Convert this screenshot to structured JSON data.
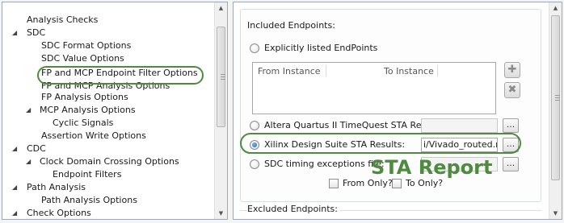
{
  "tree": {
    "items": [
      {
        "label": "Analysis Checks",
        "expander": ""
      },
      {
        "label": "SDC",
        "expander": "◢"
      },
      {
        "label": "SDC Format Options",
        "expander": ""
      },
      {
        "label": "SDC Value Options",
        "expander": ""
      },
      {
        "label": "FP and MCP Endpoint Filter Options",
        "expander": ""
      },
      {
        "label": "FP and MCP Analysis Options",
        "expander": ""
      },
      {
        "label": "FP Analysis Options",
        "expander": ""
      },
      {
        "label": "MCP Analysis Options",
        "expander": "◢"
      },
      {
        "label": "Cyclic Signals",
        "expander": ""
      },
      {
        "label": "Assertion Write Options",
        "expander": ""
      },
      {
        "label": "CDC",
        "expander": "◢"
      },
      {
        "label": "Clock Domain Crossing Options",
        "expander": "◢"
      },
      {
        "label": "Endpoint Filters",
        "expander": ""
      },
      {
        "label": "Path Analysis",
        "expander": "◢"
      },
      {
        "label": "Path Analysis Options",
        "expander": ""
      },
      {
        "label": "Check Options",
        "expander": "◢"
      }
    ]
  },
  "included": {
    "title": "Included Endpoints:",
    "option_explicit": "Explicitly listed EndPoints",
    "col_from": "From Instance",
    "col_to": "To Instance",
    "add_icon": "add-icon",
    "remove_icon": "remove-icon",
    "option_altera": "Altera Quartus II TimeQuest STA Results:",
    "altera_value": "",
    "option_xilinx": "Xilinx Design Suite STA Results:",
    "xilinx_value": "i/Vivado_routed.rpt",
    "option_sdc": "SDC timing exceptions file:",
    "sdc_value": "",
    "browse_label": "...",
    "from_only": "From Only?",
    "to_only": "To Only?"
  },
  "excluded": {
    "title": "Excluded Endpoints:"
  },
  "annotation": {
    "text": "STA Report",
    "color": "#4d8b3e"
  }
}
